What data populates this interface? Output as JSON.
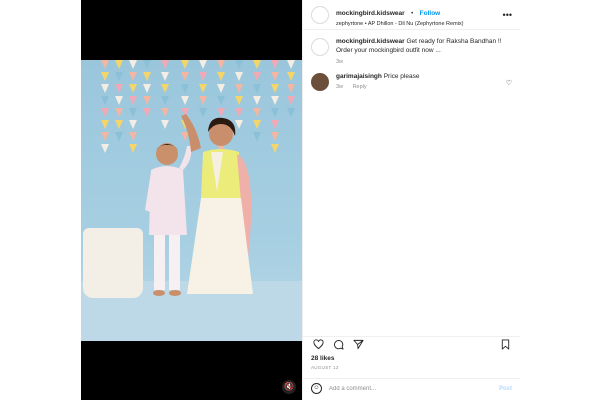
{
  "post": {
    "username": "mockingbird.kidswear",
    "separator": "•",
    "follow_label": "Follow",
    "audio": "zephyrtone • AP Dhillon - Dil Nu (Zephyrtone Remix)",
    "more_label": "•••",
    "avatar_text": "",
    "caption": {
      "username": "mockingbird.kidswear",
      "text": "Get ready for Raksha Bandhan !! Order your mockingbird outfit now ...",
      "age": "3w"
    },
    "comments": [
      {
        "username": "garimajaisingh",
        "text": "Price please",
        "age": "3w",
        "reply_label": "Reply"
      }
    ],
    "likes": "28 likes",
    "date": "AUGUST 12",
    "add_comment_placeholder": "Add a comment...",
    "post_button": "Post"
  },
  "colors": {
    "accent": "#0095f6",
    "muted": "#8e8e8e",
    "post_button_disabled": "#b3dbff"
  },
  "icons": {
    "like": "heart-icon",
    "comment": "comment-icon",
    "share": "paper-plane-icon",
    "save": "bookmark-icon",
    "mute": "speaker-muted-icon",
    "emoji": "smiley-icon",
    "comment_like": "heart-outline-icon"
  }
}
